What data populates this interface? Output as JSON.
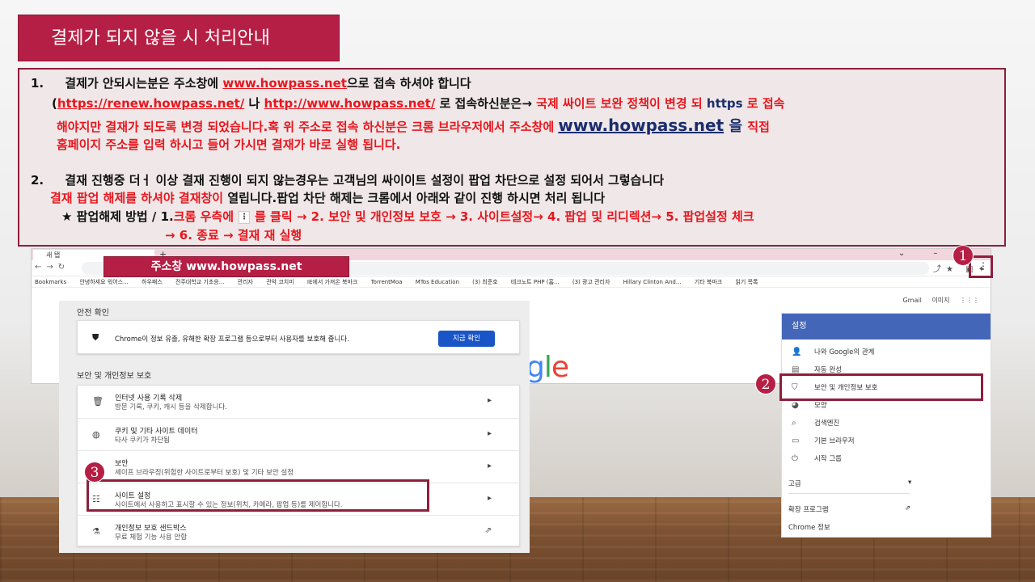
{
  "title": "결제가 되지 않을 시 처리안내",
  "notice": {
    "item1_num": "1.",
    "item1_a": "결제가 안되시는분은 주소창에 ",
    "item1_link": "www.howpass.net",
    "item1_b": "으로 접속 하셔야 합니다",
    "item1_paren_open": "(",
    "item1_link2": "https://renew.howpass.net/",
    "item1_or": " 나 ",
    "item1_link3": "http://www.howpass.net/",
    "item1_c": " 로 접속하신분은→ ",
    "item1_d": "국제 싸이트 보완 정책이 변경 되 ",
    "item1_https": "https",
    "item1_e": " 로 접속",
    "item1_line3": "해야지만 결재가 되도록 변경 되었습니다.혹 위 주소로 접속 하신분은 크롬 브라우저에서 주소창에 ",
    "item1_link4": "www.howpass.net",
    "item1_eul": " 을 ",
    "item1_jikjeop": "직접",
    "item1_line4": "홈페이지 주소를 입력 하시고 들어 가시면 결재가 바로 실행 됩니다.",
    "item2_num": "2.",
    "item2_a": "결재 진행중 더ㅓ 이상 결재 진행이 되지 않는경우는 고객님의 싸이이트 설정이 팝업 차단으로 설정 되어서 그렇습니다",
    "item2_b_red": "결재 팝업 해제를 하셔야 결재창이 ",
    "item2_b_black": "열립니다.팝업 차단 해제는 크롬에서 아래와 같이 진행 하시면 처리 됩니다",
    "item2_c_black": "★ 팝업해제 방법 / 1.",
    "item2_c_red1": "크롬 우측에",
    "item2_c_red2": "를 클릭 → 2. 보안 및 개인정보 보호 → 3. 사이트설정→ 4. 팝업 및 리디렉션→ 5. 팝업설정 체크",
    "item2_d_red": "→ 6. 종료 →   결재 재 실행"
  },
  "address_label": "주소창 www.howpass.net",
  "browser": {
    "tab_title": "새 탭",
    "bookmarks": [
      "Bookmarks",
      "안녕하세요 워어스...",
      "하우패스",
      "전주대학교 기초응...",
      "관리자",
      "관악 코치미",
      "IE에서 가져온 북마크",
      "TorrentMoa",
      "MTos Education",
      "(3) 최준호",
      "테크노트 PHP (홈...",
      "(3) 광고 관리자",
      "Hillary Clinton And...",
      "기타 북마크",
      "읽기 목록"
    ],
    "gbar": [
      "Gmail",
      "이미지"
    ],
    "logo": "gle"
  },
  "badges": [
    "1",
    "2",
    "3"
  ],
  "settings": {
    "header": "설정",
    "items": [
      "나와 Google의 관계",
      "자동 완성",
      "보안 및 개인정보 보호",
      "모양",
      "검색엔진",
      "기본 브라우저",
      "시작 그룹"
    ],
    "advanced": "고급",
    "extensions": "확장 프로그램",
    "about": "Chrome 정보"
  },
  "privacy": {
    "safety_heading": "안전 확인",
    "safety_text": "Chrome이 정보 유출, 유해한 확장 프로그램 등으로부터 사용자를 보호해 줍니다.",
    "safety_button": "지금 확인",
    "section_heading": "보안 및 개인정보 보호",
    "rows": [
      {
        "title": "인터넷 사용 기록 삭제",
        "desc": "방문 기록, 쿠키, 캐시 등을 삭제합니다."
      },
      {
        "title": "쿠키 및 기타 사이트 데이터",
        "desc": "타사 쿠키가 차단됨"
      },
      {
        "title": "보안",
        "desc": "세이프 브라우징(위험한 사이트로부터 보호) 및 기타 보안 설정"
      },
      {
        "title": "사이트 설정",
        "desc": "사이트에서 사용하고 표시할 수 있는 정보(위치, 카메라, 팝업 등)를 제어합니다."
      },
      {
        "title": "개인정보 보호 샌드박스",
        "desc": "무료 체험 기능 사용 안함"
      }
    ]
  },
  "colors": {
    "accent": "#b61f45",
    "red_text": "#e8161e",
    "blue_text": "#1a2d6e",
    "chrome_blue": "#4466b8"
  }
}
